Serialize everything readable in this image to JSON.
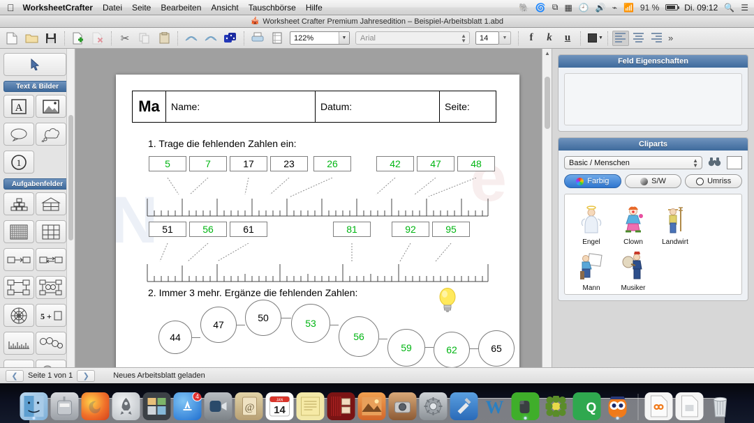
{
  "menubar": {
    "apple_icon": "apple-icon",
    "app_name": "WorksheetCrafter",
    "items": [
      "Datei",
      "Seite",
      "Bearbeiten",
      "Ansicht",
      "Tauschbörse",
      "Hilfe"
    ],
    "status_icons": [
      "evernote-icon",
      "dropbox-icon",
      "airplay-icon",
      "flux-icon",
      "timemachine-icon",
      "volume-icon",
      "bluetooth-icon",
      "wifi-icon"
    ],
    "battery_percent": "91 %",
    "clock": "Di. 09:12",
    "spotlight_icon": "search-icon",
    "notification_icon": "notification-list-icon"
  },
  "titlebar": {
    "icon": "app-document-icon",
    "title": "Worksheet Crafter Premium Jahresedition – Beispiel-Arbeitsblatt 1.abd"
  },
  "toolbar": {
    "buttons": [
      {
        "name": "new-document-button",
        "glyph": "🗋"
      },
      {
        "name": "open-folder-button",
        "glyph": "🗀"
      },
      {
        "name": "save-button",
        "glyph": "💾"
      },
      {
        "name": "add-page-button",
        "glyph": "🗋"
      },
      {
        "name": "delete-page-button",
        "glyph": "🗋"
      },
      {
        "name": "cut-button",
        "glyph": "✂"
      },
      {
        "name": "copy-button",
        "glyph": "🗐"
      },
      {
        "name": "paste-button",
        "glyph": "📋"
      },
      {
        "name": "undo-button",
        "glyph": "↶"
      },
      {
        "name": "redo-button",
        "glyph": "↷"
      },
      {
        "name": "dice-button",
        "glyph": "🎲"
      },
      {
        "name": "print-button",
        "glyph": "🖨"
      },
      {
        "name": "page-layout-button",
        "glyph": "▤"
      }
    ],
    "zoom_value": "122%",
    "font_name_placeholder": "Arial",
    "font_size": "14",
    "bold_label": "f",
    "italic_label": "k",
    "underline_label": "u",
    "color_label": "text-color",
    "align_left": "align-left",
    "align_center": "align-center",
    "align_right": "align-right",
    "overflow_label": "»"
  },
  "palette": {
    "pointer_tool": "pointer-tool",
    "sections": [
      {
        "title": "Text & Bilder",
        "tools": [
          "text-field-tool",
          "image-tool"
        ]
      },
      {
        "title": "Aufgabenfelder",
        "tools": [
          "number-pyramid-tool",
          "number-house-tool"
        ]
      }
    ],
    "loose_tools": [
      "speech-bubble-tool",
      "thought-bubble-tool",
      "numbering-tool"
    ],
    "grid_tools": [
      "dotted-grid-tool",
      "table-tool",
      "arrow-chain-tool",
      "double-arrow-chain-tool",
      "flow-network-tool",
      "flow-network-nodes-tool",
      "number-wheel-tool",
      "calc-equation-tool",
      "number-line-tool",
      "number-chain-tool",
      "clock-tool",
      "money-tool"
    ]
  },
  "worksheet": {
    "header": {
      "subject": "Ma",
      "name_label": "Name:",
      "date_label": "Datum:",
      "page_label": "Seite:"
    },
    "watermark_left": "N",
    "watermark_right": "e",
    "task1": {
      "instruction": "1. Trage die fehlenden Zahlen ein:",
      "line1": {
        "range": [
          0,
          50
        ],
        "boxes": [
          {
            "value": "5",
            "filled": true,
            "pos": 5
          },
          {
            "value": "7",
            "filled": true,
            "pos": 7
          },
          {
            "value": "17",
            "filled": false,
            "pos": 17
          },
          {
            "value": "23",
            "filled": false,
            "pos": 23
          },
          {
            "value": "26",
            "filled": true,
            "pos": 29
          },
          {
            "value": "42",
            "filled": true,
            "pos": 42
          },
          {
            "value": "47",
            "filled": true,
            "pos": 47
          },
          {
            "value": "48",
            "filled": true,
            "pos": 50
          }
        ]
      },
      "line2": {
        "range": [
          50,
          100
        ],
        "boxes": [
          {
            "value": "51",
            "filled": false,
            "pos": 51
          },
          {
            "value": "56",
            "filled": true,
            "pos": 56
          },
          {
            "value": "61",
            "filled": false,
            "pos": 61
          },
          {
            "value": "81",
            "filled": true,
            "pos": 81
          },
          {
            "value": "92",
            "filled": true,
            "pos": 92
          },
          {
            "value": "95",
            "filled": true,
            "pos": 95
          }
        ]
      }
    },
    "task2": {
      "instruction": "2. Immer 3 mehr. Ergänze die fehlenden Zahlen:",
      "hint_icon": "lightbulb-icon",
      "bubbles": [
        {
          "value": "44",
          "filled": false
        },
        {
          "value": "47",
          "filled": false
        },
        {
          "value": "50",
          "filled": false
        },
        {
          "value": "53",
          "filled": true
        },
        {
          "value": "56",
          "filled": true
        },
        {
          "value": "59",
          "filled": true
        },
        {
          "value": "62",
          "filled": true
        },
        {
          "value": "65",
          "filled": false
        }
      ]
    }
  },
  "inspector": {
    "field_properties": {
      "title": "Feld Eigenschaften"
    },
    "cliparts": {
      "title": "Cliparts",
      "category": "Basic / Menschen",
      "search_icon": "binoculars-icon",
      "swatch": "#ffffff",
      "modes": [
        {
          "label": "Farbig",
          "icon": "color-wheel-icon",
          "active": true
        },
        {
          "label": "S/W",
          "icon": "grayscale-icon",
          "active": false
        },
        {
          "label": "Umriss",
          "icon": "outline-circle-icon",
          "active": false
        }
      ],
      "items": [
        {
          "label": "Engel",
          "art": "angel-clipart",
          "glyph": "👼"
        },
        {
          "label": "Clown",
          "art": "clown-clipart",
          "glyph": "🤡"
        },
        {
          "label": "Landwirt",
          "art": "farmer-clipart",
          "glyph": "👨‍🌾"
        },
        {
          "label": "Mann",
          "art": "man-clipart",
          "glyph": "🧑‍🎨"
        },
        {
          "label": "Musiker",
          "art": "musician-clipart",
          "glyph": "🥁"
        }
      ]
    }
  },
  "statusbar": {
    "prev_label": "❮",
    "next_label": "❯",
    "page_info": "Seite 1 von 1",
    "message": "Neues Arbeitsblatt geladen"
  },
  "dock": {
    "items": [
      {
        "name": "finder",
        "glyph": "🙂",
        "bg": "#a8cbe8",
        "running": true
      },
      {
        "name": "mail-postbox",
        "glyph": "📪",
        "bg": "#b8bcc0",
        "running": false
      },
      {
        "name": "firefox",
        "glyph": "🦊",
        "bg": "#f08a24",
        "running": false
      },
      {
        "name": "launchpad",
        "glyph": "🚀",
        "bg": "#c9cdd1",
        "running": false
      },
      {
        "name": "dashboard",
        "glyph": "🗂",
        "bg": "#4a4f55",
        "running": false
      },
      {
        "name": "app-store",
        "glyph": "🅐",
        "bg": "#2f8fe0",
        "running": false,
        "badge": "4"
      },
      {
        "name": "facetime",
        "glyph": "📹",
        "bg": "#8e9399",
        "running": false
      },
      {
        "name": "address-book",
        "glyph": "@",
        "bg": "#d9c79a",
        "running": false
      },
      {
        "name": "calendar",
        "glyph": "14",
        "bg": "#ffffff",
        "running": false
      },
      {
        "name": "stickies",
        "glyph": "🗒",
        "bg": "#f3e7a3",
        "running": false
      },
      {
        "name": "photo-booth",
        "glyph": "🎭",
        "bg": "#9b2020",
        "running": false
      },
      {
        "name": "iphoto",
        "glyph": "🏝",
        "bg": "#d98030",
        "running": false
      },
      {
        "name": "image-capture",
        "glyph": "📷",
        "bg": "#8b5a3c",
        "running": false
      },
      {
        "name": "system-preferences",
        "glyph": "⚙",
        "bg": "#9a9a9a",
        "running": false
      },
      {
        "name": "xcode",
        "glyph": "🔨",
        "bg": "#3c7fd0",
        "running": false
      },
      {
        "name": "microsoft-word",
        "glyph": "W",
        "bg": "#2a7fc1",
        "running": false
      },
      {
        "name": "evernote",
        "glyph": "🐘",
        "bg": "#3fae2a",
        "running": true
      },
      {
        "name": "plant-app",
        "glyph": "🌿",
        "bg": "#5a8c2a",
        "running": false
      },
      {
        "name": "qt-creator",
        "glyph": "Qt",
        "bg": "#2fa84f",
        "running": false
      },
      {
        "name": "worksheet-crafter",
        "glyph": "🦉",
        "bg": "#f07a1a",
        "running": true
      }
    ],
    "right_items": [
      {
        "name": "worksheet-document",
        "glyph": "🦉",
        "bg": "#f3f3f3"
      },
      {
        "name": "generic-document",
        "glyph": "📄",
        "bg": "#f3f3f3"
      },
      {
        "name": "trash",
        "glyph": "🗑",
        "bg": "#cfd4d8"
      }
    ]
  }
}
